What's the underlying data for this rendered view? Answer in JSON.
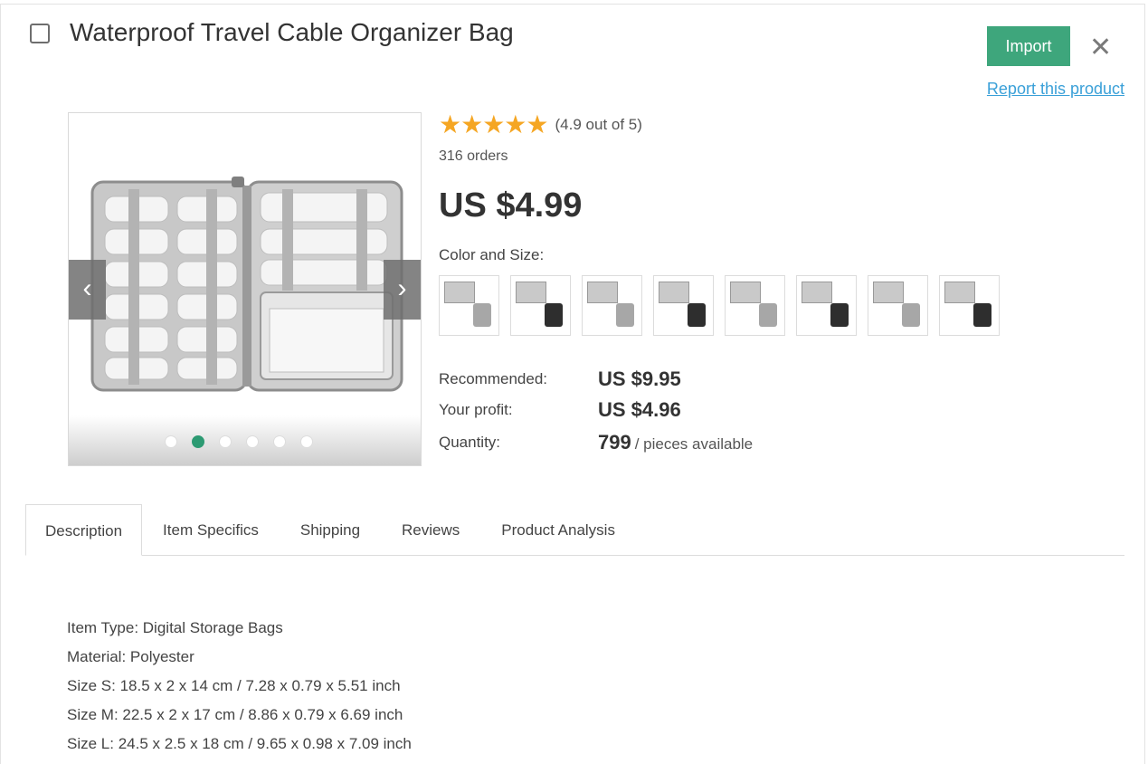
{
  "product": {
    "title": "Waterproof Travel Cable Organizer Bag",
    "import_label": "Import",
    "close_label": "✕",
    "report_label": "Report this product",
    "rating_stars": 4.9,
    "rating_text": "(4.9 out of 5)",
    "orders": "316 orders",
    "price": "US $4.99",
    "color_size_label": "Color and Size:",
    "swatches": [
      {
        "variant": "light"
      },
      {
        "variant": "dark"
      },
      {
        "variant": "light"
      },
      {
        "variant": "dark"
      },
      {
        "variant": "light"
      },
      {
        "variant": "dark"
      },
      {
        "variant": "light"
      },
      {
        "variant": "dark"
      }
    ],
    "recommended_label": "Recommended:",
    "recommended_value": "US $9.95",
    "profit_label": "Your profit:",
    "profit_value": "US $4.96",
    "quantity_label": "Quantity:",
    "quantity_value": "799",
    "quantity_suffix": "/ pieces available"
  },
  "gallery": {
    "dot_count": 6,
    "active_dot": 2,
    "prev_icon": "chevron-left-icon",
    "next_icon": "chevron-right-icon"
  },
  "tabs": [
    {
      "label": "Description",
      "active": true
    },
    {
      "label": "Item Specifics",
      "active": false
    },
    {
      "label": "Shipping",
      "active": false
    },
    {
      "label": "Reviews",
      "active": false
    },
    {
      "label": "Product Analysis",
      "active": false
    }
  ],
  "description": [
    "Item Type: Digital Storage Bags",
    "Material: Polyester",
    "Size S: 18.5 x 2 x 14 cm / 7.28 x 0.79 x 5.51 inch",
    "Size M: 22.5 x 2 x 17 cm / 8.86 x 0.79 x 6.69 inch",
    "Size L: 24.5 x 2.5 x 18 cm / 9.65 x 0.98 x 7.09 inch"
  ],
  "colors": {
    "accent": "#3ea67c",
    "link": "#3aa0d8",
    "star": "#f5a623"
  }
}
